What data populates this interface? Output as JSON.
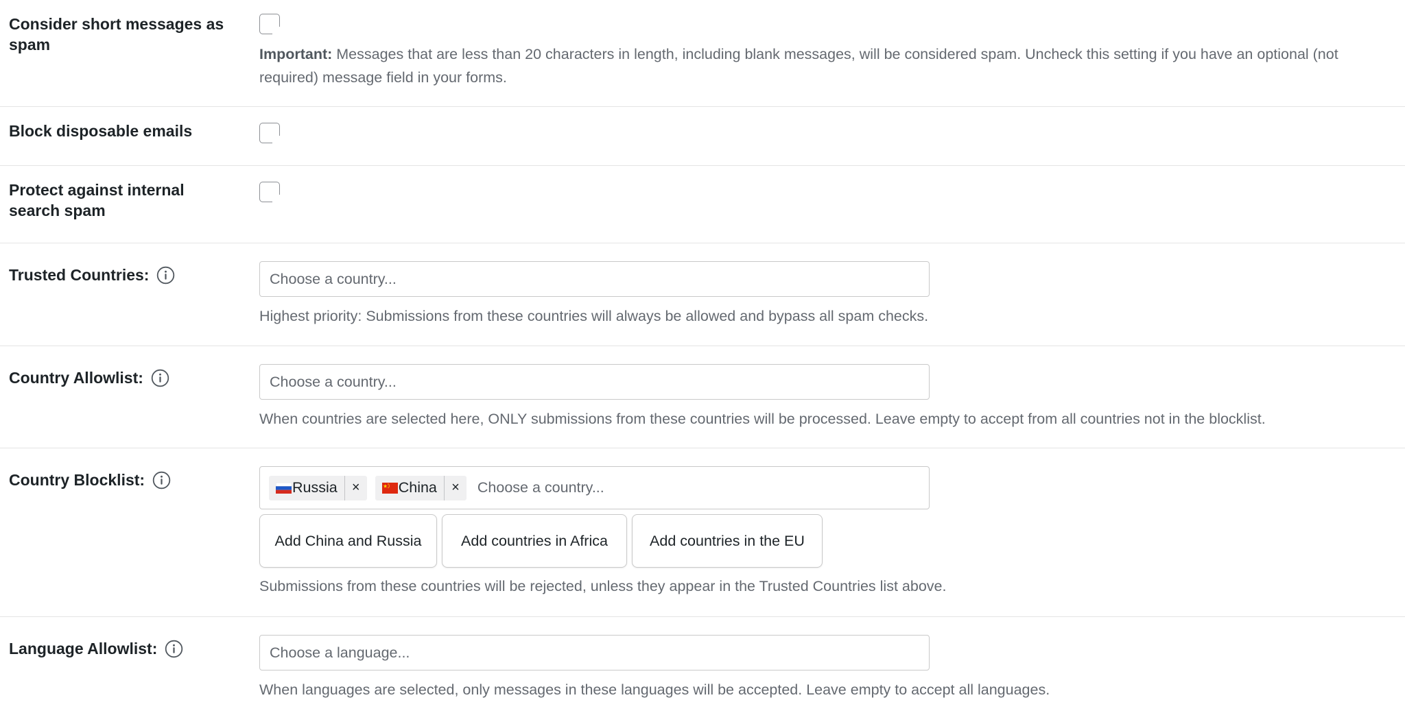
{
  "rows": {
    "short_messages": {
      "label": "Consider short messages as spam",
      "desc_bold": "Important:",
      "desc": " Messages that are less than 20 characters in length, including blank messages, will be considered spam. Uncheck this setting if you have an optional (not required) message field in your forms."
    },
    "disposable": {
      "label": "Block disposable emails"
    },
    "internal_search": {
      "label": "Protect against internal search spam"
    },
    "trusted_countries": {
      "label": "Trusted Countries:",
      "placeholder": "Choose a country...",
      "desc": "Highest priority: Submissions from these countries will always be allowed and bypass all spam checks."
    },
    "country_allowlist": {
      "label": "Country Allowlist:",
      "placeholder": "Choose a country...",
      "desc": "When countries are selected here, ONLY submissions from these countries will be processed. Leave empty to accept from all countries not in the blocklist."
    },
    "country_blocklist": {
      "label": "Country Blocklist:",
      "tags": [
        {
          "label": "Russia",
          "remove": "×"
        },
        {
          "label": "China",
          "remove": "×"
        }
      ],
      "placeholder": "Choose a country...",
      "buttons": [
        "Add China and Russia",
        "Add countries in Africa",
        "Add countries in the EU"
      ],
      "desc": "Submissions from these countries will be rejected, unless they appear in the Trusted Countries list above."
    },
    "language_allowlist": {
      "label": "Language Allowlist:",
      "placeholder": "Choose a language...",
      "desc": "When languages are selected, only messages in these languages will be accepted. Leave empty to accept all languages."
    }
  },
  "icons": {
    "info": "info-circle-icon",
    "flag_russia": "russia-flag-icon",
    "flag_china": "china-flag-icon"
  },
  "colors": {
    "label_text": "#1d2327",
    "description_text": "#646970",
    "border": "#c9c9c9",
    "divider": "#e4e4e4",
    "tag_background": "#f0f0f1"
  }
}
